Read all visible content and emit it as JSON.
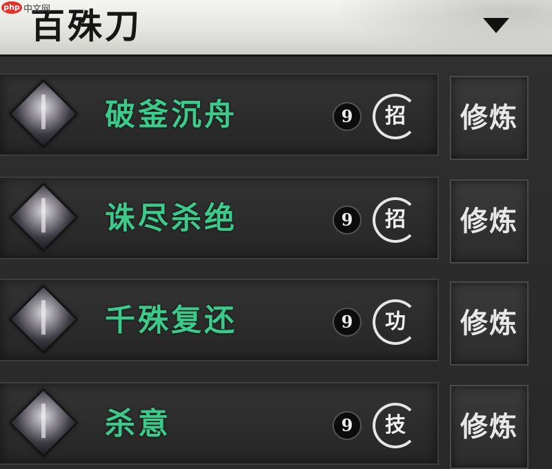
{
  "header": {
    "title": "百殊刀",
    "logo_text": "php",
    "watermark": "中文网"
  },
  "skills": [
    {
      "name": "破釜沉舟",
      "level": "9",
      "type": "招",
      "action": "修炼"
    },
    {
      "name": "诛尽杀绝",
      "level": "9",
      "type": "招",
      "action": "修炼"
    },
    {
      "name": "千殊复还",
      "level": "9",
      "type": "功",
      "action": "修炼"
    },
    {
      "name": "杀意",
      "level": "9",
      "type": "技",
      "action": "修炼"
    }
  ],
  "colors": {
    "skill_name": "#3dc98a",
    "panel_bg": "#2b2b2b",
    "header_bg": "#e4e4e0"
  }
}
